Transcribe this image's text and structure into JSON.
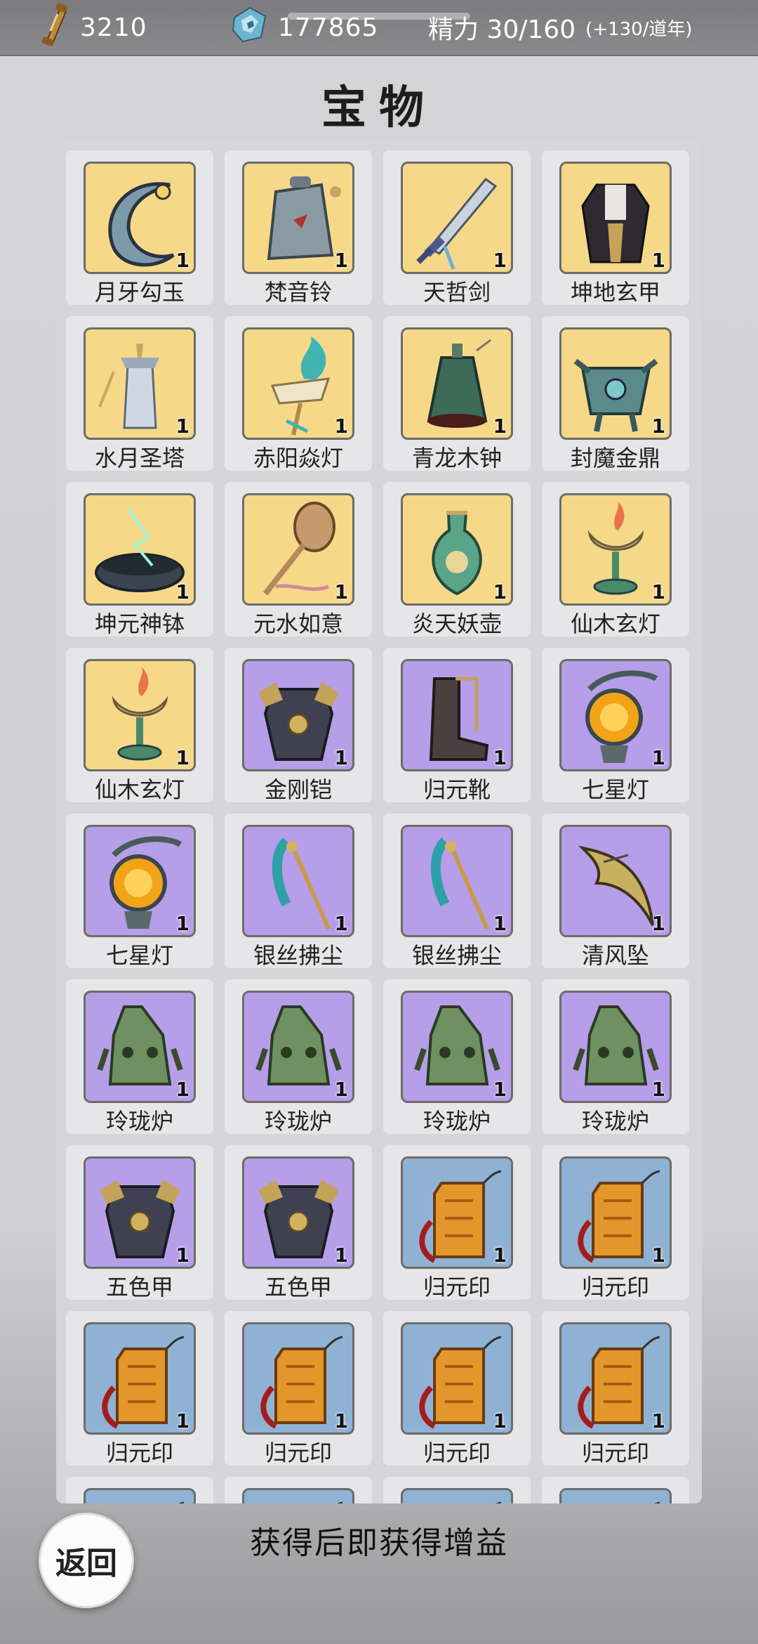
{
  "topbar": {
    "scroll_count": "3210",
    "scroll_icon": "scroll-icon",
    "crystal_count": "177865",
    "crystal_icon": "crystal-icon",
    "energy_label": "精力 30/160",
    "energy_rate": "(+130/道年)"
  },
  "title": "宝物",
  "rarity_colors": {
    "gold": "#f6d889",
    "purple": "#b69ee8",
    "blue": "#8fb2d4"
  },
  "items": [
    {
      "name": "月牙勾玉",
      "count": "1",
      "rarity": "gold",
      "icon": "crescent-jade"
    },
    {
      "name": "梵音铃",
      "count": "1",
      "rarity": "gold",
      "icon": "bell"
    },
    {
      "name": "天哲剑",
      "count": "1",
      "rarity": "gold",
      "icon": "sword"
    },
    {
      "name": "坤地玄甲",
      "count": "1",
      "rarity": "gold",
      "icon": "armor-robe"
    },
    {
      "name": "水月圣塔",
      "count": "1",
      "rarity": "gold",
      "icon": "tower"
    },
    {
      "name": "赤阳焱灯",
      "count": "1",
      "rarity": "gold",
      "icon": "flame-lamp"
    },
    {
      "name": "青龙木钟",
      "count": "1",
      "rarity": "gold",
      "icon": "big-bell"
    },
    {
      "name": "封魔金鼎",
      "count": "1",
      "rarity": "gold",
      "icon": "cauldron"
    },
    {
      "name": "坤元神钵",
      "count": "1",
      "rarity": "gold",
      "icon": "bowl"
    },
    {
      "name": "元水如意",
      "count": "1",
      "rarity": "gold",
      "icon": "ruyi"
    },
    {
      "name": "炎天妖壶",
      "count": "1",
      "rarity": "gold",
      "icon": "vase"
    },
    {
      "name": "仙木玄灯",
      "count": "1",
      "rarity": "gold",
      "icon": "lotus-lamp"
    },
    {
      "name": "仙木玄灯",
      "count": "1",
      "rarity": "gold",
      "icon": "lotus-lamp"
    },
    {
      "name": "金刚铠",
      "count": "1",
      "rarity": "purple",
      "icon": "armor"
    },
    {
      "name": "归元靴",
      "count": "1",
      "rarity": "purple",
      "icon": "boots"
    },
    {
      "name": "七星灯",
      "count": "1",
      "rarity": "purple",
      "icon": "orb-lamp"
    },
    {
      "name": "七星灯",
      "count": "1",
      "rarity": "purple",
      "icon": "orb-lamp"
    },
    {
      "name": "银丝拂尘",
      "count": "1",
      "rarity": "purple",
      "icon": "whisk"
    },
    {
      "name": "银丝拂尘",
      "count": "1",
      "rarity": "purple",
      "icon": "whisk"
    },
    {
      "name": "清风坠",
      "count": "1",
      "rarity": "purple",
      "icon": "pendant"
    },
    {
      "name": "玲珑炉",
      "count": "1",
      "rarity": "purple",
      "icon": "furnace"
    },
    {
      "name": "玲珑炉",
      "count": "1",
      "rarity": "purple",
      "icon": "furnace"
    },
    {
      "name": "玲珑炉",
      "count": "1",
      "rarity": "purple",
      "icon": "furnace"
    },
    {
      "name": "玲珑炉",
      "count": "1",
      "rarity": "purple",
      "icon": "furnace"
    },
    {
      "name": "五色甲",
      "count": "1",
      "rarity": "purple",
      "icon": "armor"
    },
    {
      "name": "五色甲",
      "count": "1",
      "rarity": "purple",
      "icon": "armor"
    },
    {
      "name": "归元印",
      "count": "1",
      "rarity": "blue",
      "icon": "seal"
    },
    {
      "name": "归元印",
      "count": "1",
      "rarity": "blue",
      "icon": "seal"
    },
    {
      "name": "归元印",
      "count": "1",
      "rarity": "blue",
      "icon": "seal"
    },
    {
      "name": "归元印",
      "count": "1",
      "rarity": "blue",
      "icon": "seal"
    },
    {
      "name": "归元印",
      "count": "1",
      "rarity": "blue",
      "icon": "seal"
    },
    {
      "name": "归元印",
      "count": "1",
      "rarity": "blue",
      "icon": "seal"
    },
    {
      "name": "",
      "count": "",
      "rarity": "blue",
      "icon": "seal"
    },
    {
      "name": "",
      "count": "",
      "rarity": "blue",
      "icon": "seal"
    },
    {
      "name": "",
      "count": "",
      "rarity": "blue",
      "icon": "seal"
    },
    {
      "name": "",
      "count": "",
      "rarity": "blue",
      "icon": "seal"
    }
  ],
  "footer": {
    "note": "获得后即获得增益",
    "back_label": "返回"
  }
}
